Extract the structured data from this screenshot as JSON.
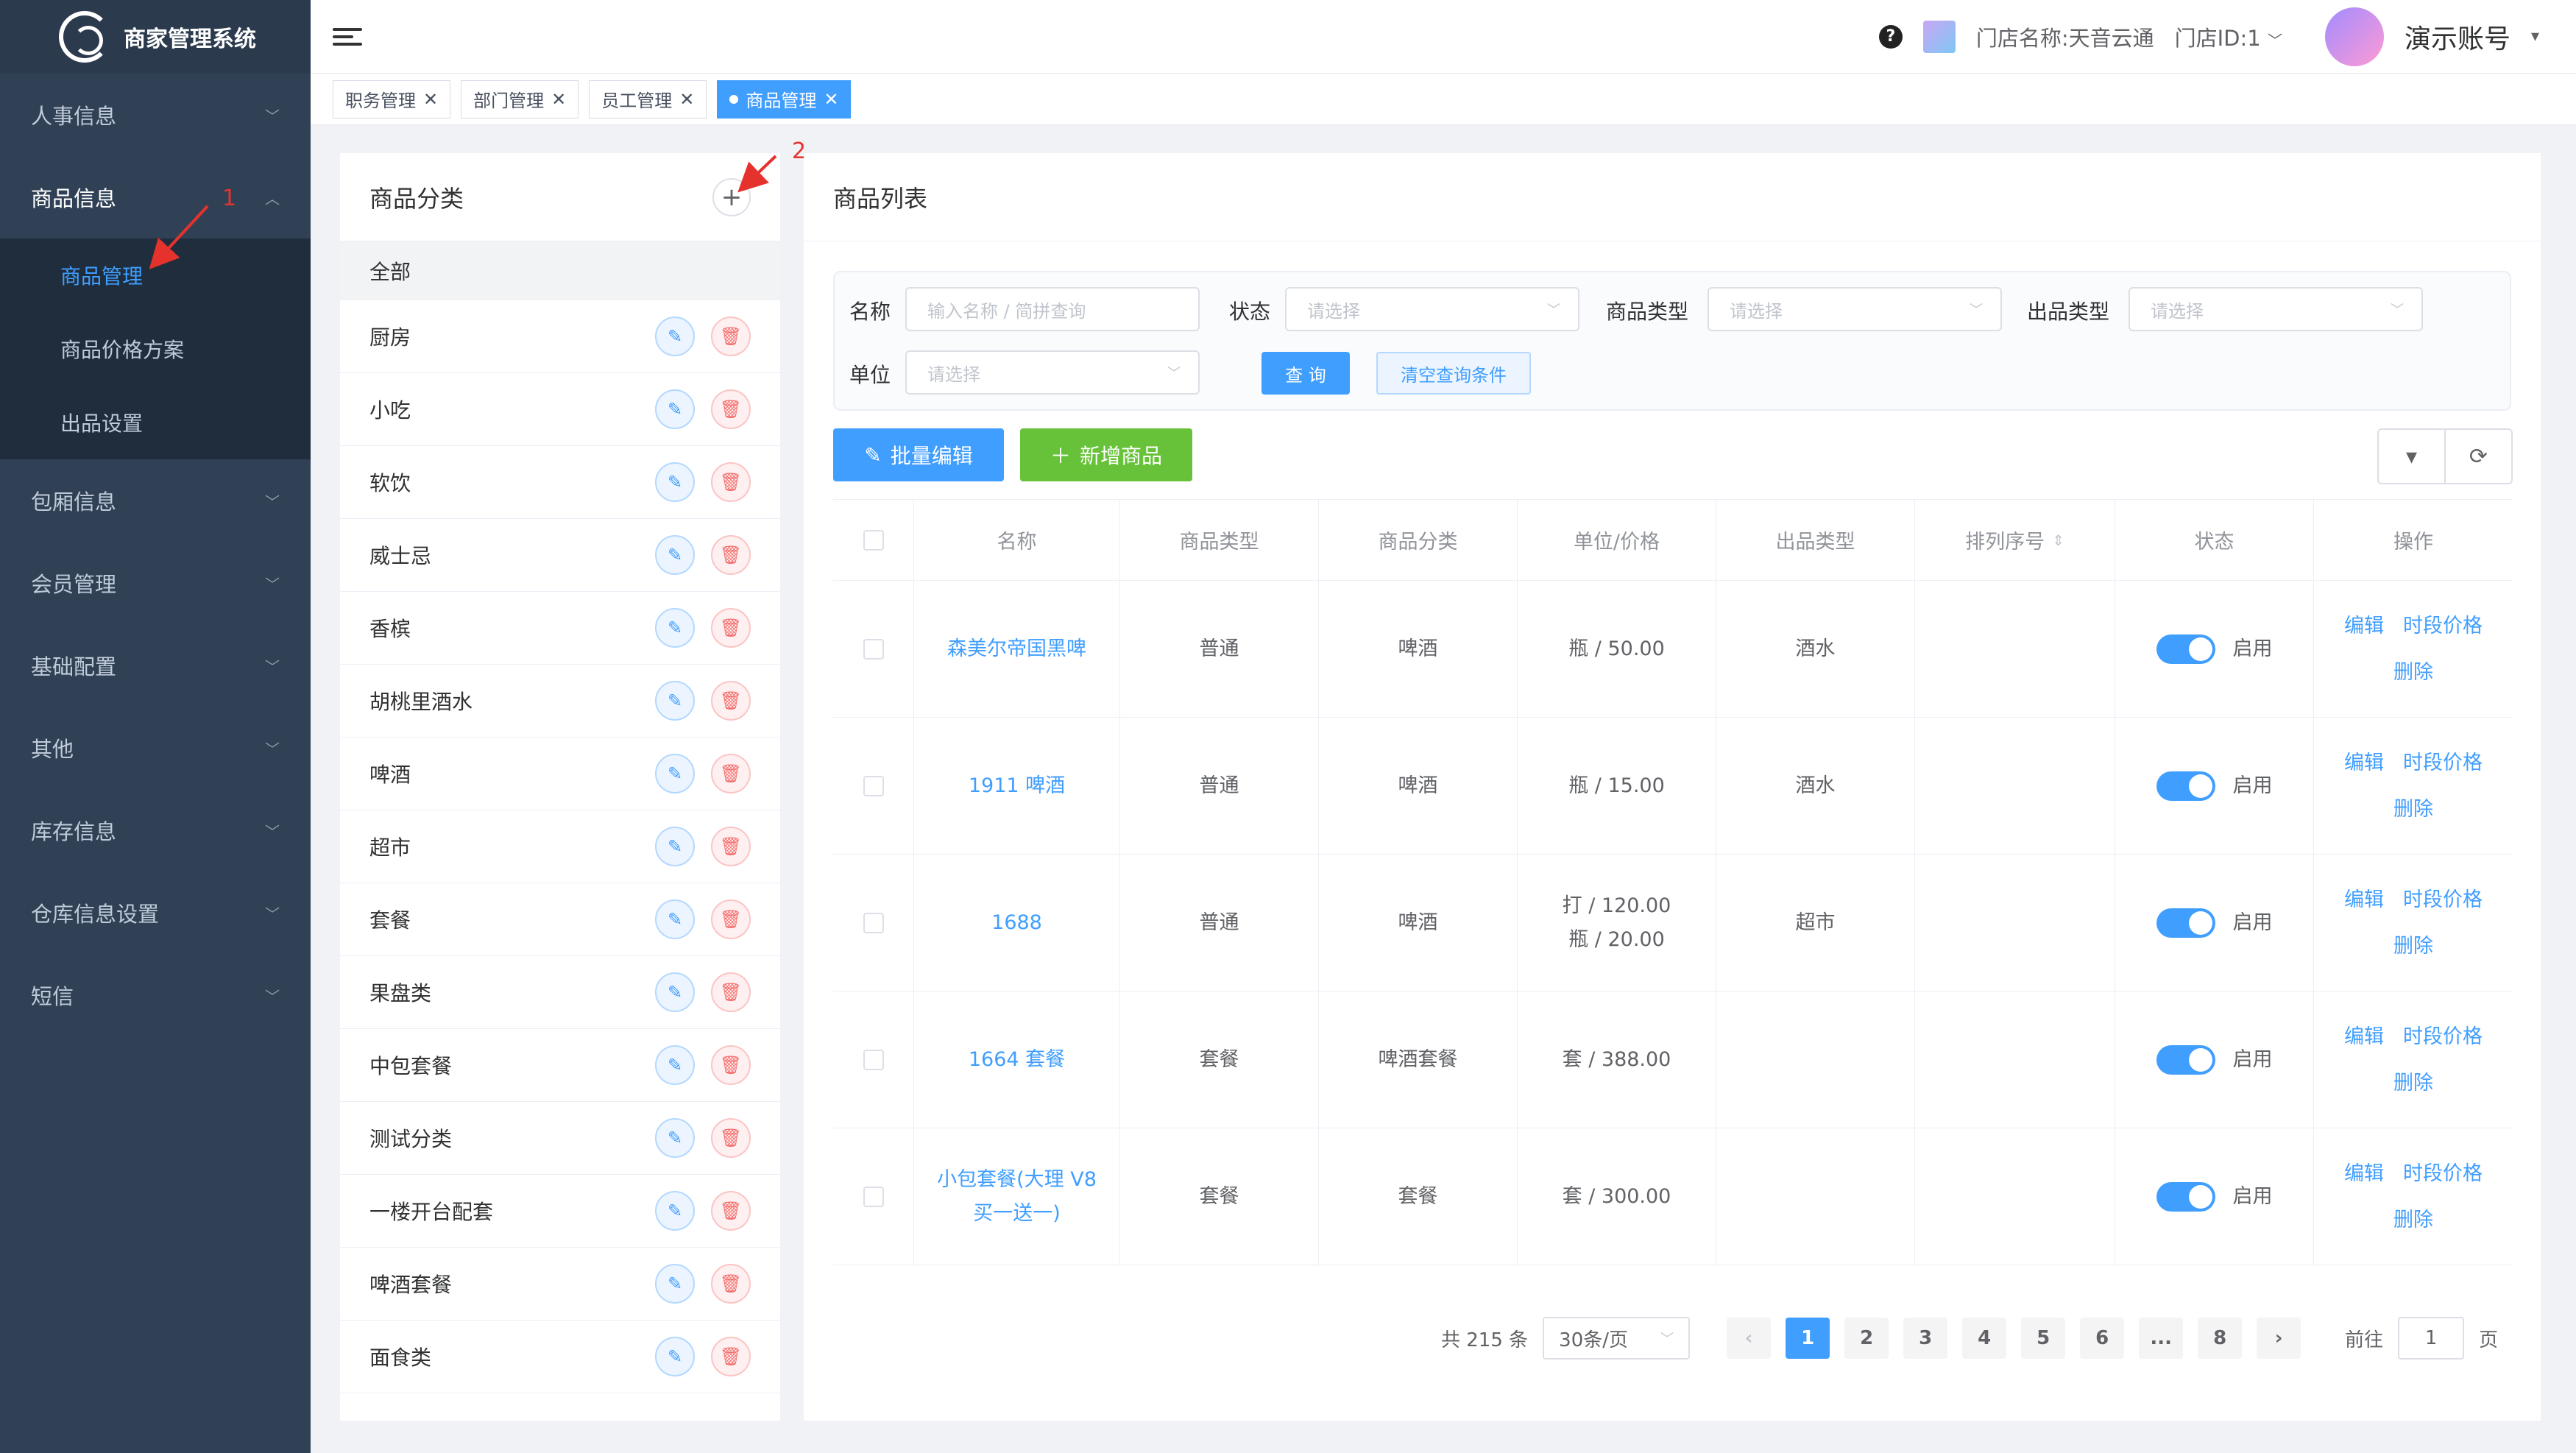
{
  "app": {
    "title": "商家管理系统"
  },
  "sidebar": {
    "menus": [
      {
        "label": "人事信息"
      },
      {
        "label": "商品信息",
        "children": [
          "商品管理",
          "商品价格方案",
          "出品设置"
        ]
      },
      {
        "label": "包厢信息"
      },
      {
        "label": "会员管理"
      },
      {
        "label": "基础配置"
      },
      {
        "label": "其他"
      },
      {
        "label": "库存信息"
      },
      {
        "label": "仓库信息设置"
      },
      {
        "label": "短信"
      }
    ]
  },
  "header": {
    "store_name": "门店名称:天音云通",
    "store_id": "门店ID:1",
    "account": "演示账号"
  },
  "tags": [
    "职务管理",
    "部门管理",
    "员工管理",
    "商品管理"
  ],
  "annotations": [
    "1",
    "2"
  ],
  "category_panel": {
    "title": "商品分类",
    "all_label": "全部",
    "items": [
      "厨房",
      "小吃",
      "软饮",
      "威士忌",
      "香槟",
      "胡桃里酒水",
      "啤酒",
      "超市",
      "套餐",
      "果盘类",
      "中包套餐",
      "测试分类",
      "一楼开台配套",
      "啤酒套餐",
      "面食类"
    ]
  },
  "product_panel": {
    "title": "商品列表",
    "filters": {
      "name_label": "名称",
      "name_placeholder": "输入名称 / 简拼查询",
      "status_label": "状态",
      "status_placeholder": "请选择",
      "ptype_label": "商品类型",
      "ptype_placeholder": "请选择",
      "otype_label": "出品类型",
      "otype_placeholder": "请选择",
      "unit_label": "单位",
      "unit_placeholder": "请选择",
      "query_btn": "查 询",
      "clear_btn": "清空查询条件"
    },
    "actions": {
      "batch_edit": "批量编辑",
      "add_new": "新增商品"
    },
    "columns": [
      "名称",
      "商品类型",
      "商品分类",
      "单位/价格",
      "出品类型",
      "排列序号",
      "状态",
      "操作"
    ],
    "rows": [
      {
        "name": "森美尔帝国黑啤",
        "type": "普通",
        "category": "啤酒",
        "price1": "瓶 / 50.00",
        "price2": "",
        "output": "酒水",
        "status": "启用"
      },
      {
        "name": "1911 啤酒",
        "type": "普通",
        "category": "啤酒",
        "price1": "瓶 / 15.00",
        "price2": "",
        "output": "酒水",
        "status": "启用"
      },
      {
        "name": "1688",
        "type": "普通",
        "category": "啤酒",
        "price1": "打 / 120.00",
        "price2": "瓶 / 20.00",
        "output": "超市",
        "status": "启用"
      },
      {
        "name": "1664 套餐",
        "type": "套餐",
        "category": "啤酒套餐",
        "price1": "套 / 388.00",
        "price2": "",
        "output": "",
        "status": "启用"
      },
      {
        "name": "小包套餐(大理 V8 买一送一)",
        "type": "套餐",
        "category": "套餐",
        "price1": "套 / 300.00",
        "price2": "",
        "output": "",
        "status": "启用"
      }
    ],
    "row_ops": {
      "edit": "编辑",
      "period_price": "时段价格",
      "delete": "删除"
    },
    "pagination": {
      "total": "共 215 条",
      "page_size": "30条/页",
      "pages": [
        "1",
        "2",
        "3",
        "4",
        "5",
        "6",
        "...",
        "8"
      ],
      "goto_label": "前往",
      "goto_value": "1",
      "page_unit": "页"
    }
  }
}
